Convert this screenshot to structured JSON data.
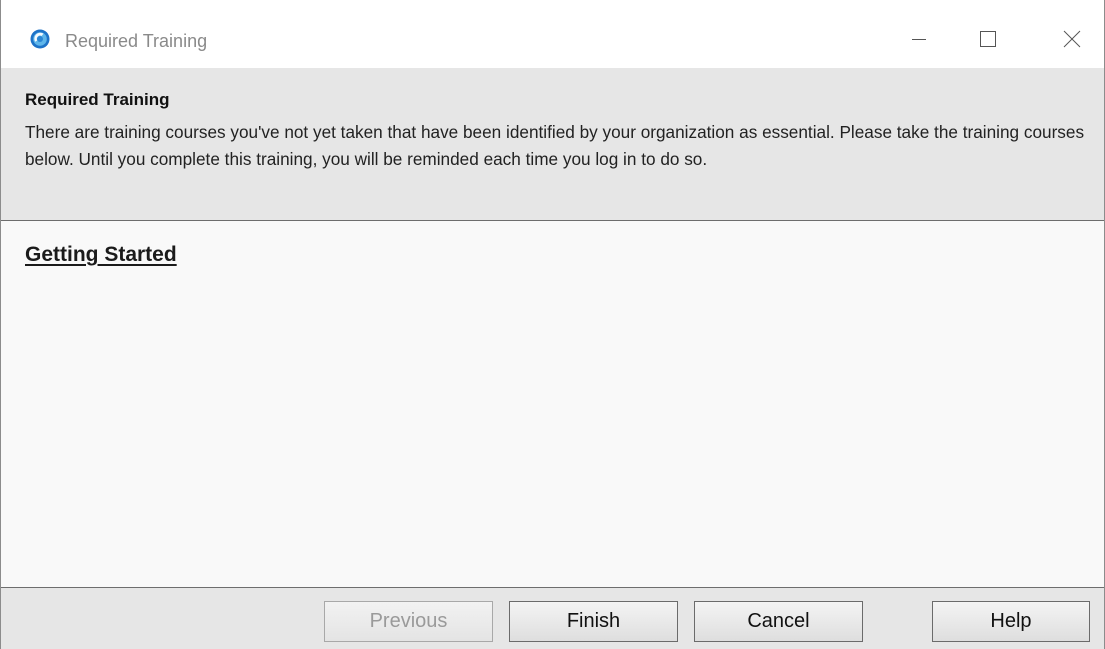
{
  "window": {
    "title": "Required Training",
    "icon": "app-circle-icon",
    "controls": {
      "minimize_icon": "minimize-icon",
      "maximize_icon": "maximize-icon",
      "close_icon": "close-icon"
    }
  },
  "header": {
    "title": "Required Training",
    "description": "There are training courses you've not yet taken that have been identified by your organization as essential. Please take the training courses below.  Until you complete this training, you will be reminded each time you log in to do so."
  },
  "courses": [
    {
      "label": "Getting Started"
    }
  ],
  "footer": {
    "previous_label": "Previous",
    "finish_label": "Finish",
    "cancel_label": "Cancel",
    "help_label": "Help"
  },
  "colors": {
    "icon_blue": "#1e73c8",
    "icon_light": "#7ec6ef",
    "header_bg": "#e6e6e6",
    "content_bg": "#f9f9f9"
  }
}
